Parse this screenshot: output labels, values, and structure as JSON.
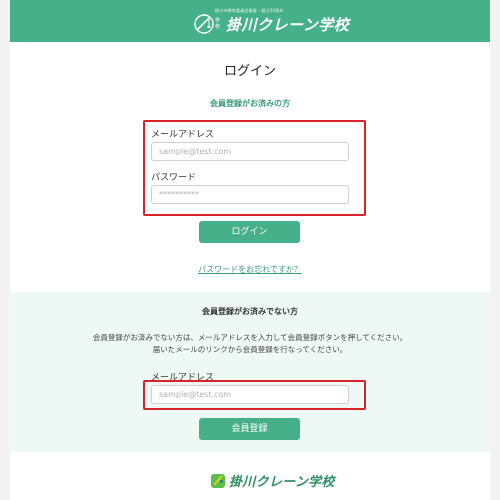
{
  "header": {
    "subtitle": "掛川市教育委員会後援 · 創立50周年",
    "logo_tag": "学校",
    "logo_text": "掛川クレーン学校"
  },
  "login": {
    "title": "ログイン",
    "member_heading": "会員登録がお済みの方",
    "email_label": "メールアドレス",
    "email_placeholder": "sample@test.com",
    "password_label": "パスワード",
    "password_placeholder": "**********",
    "login_button": "ログイン",
    "forgot_link": "パスワードをお忘れですか？"
  },
  "guest": {
    "heading": "会員登録がお済みでない方",
    "desc_line1": "会員登録がお済みでない方は、メールアドレスを入力して会員登録ボタンを押してください。",
    "desc_line2": "届いたメールのリンクから会員登録を行なってください。",
    "email_label": "メールアドレス",
    "email_placeholder": "sample@test.com",
    "register_button": "会員登録"
  },
  "footer": {
    "logo_text": "掛川クレーン学校"
  },
  "colors": {
    "brand_green": "#46b08a",
    "highlight_red": "#d8232a",
    "panel_bg": "#eef8f5"
  }
}
